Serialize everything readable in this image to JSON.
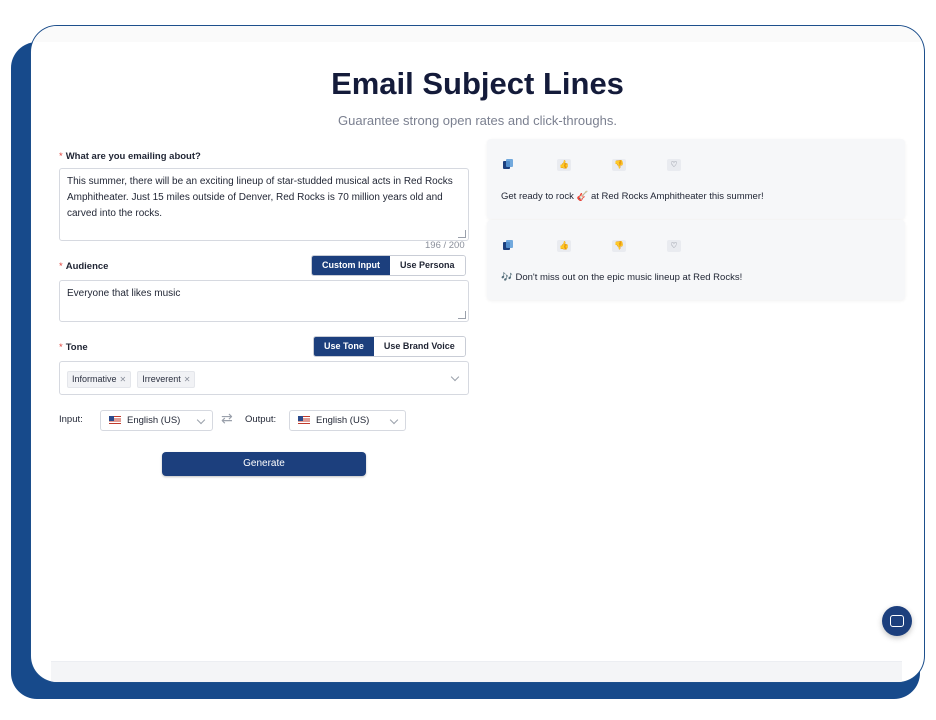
{
  "header": {
    "title": "Email Subject Lines",
    "subtitle": "Guarantee strong open rates and click-throughs."
  },
  "form": {
    "topic": {
      "label": "What are you emailing about?",
      "value": "This summer, there will be an exciting lineup of star-studded musical acts in Red Rocks Amphitheater. Just 15 miles outside of Denver, Red Rocks is 70 million years old and carved into the rocks.",
      "counter": "196 / 200"
    },
    "audience": {
      "label": "Audience",
      "value": "Everyone that likes music",
      "options": [
        "Custom Input",
        "Use Persona"
      ],
      "selected": "Custom Input"
    },
    "tone": {
      "label": "Tone",
      "options": [
        "Use Tone",
        "Use Brand Voice"
      ],
      "selected": "Use Tone",
      "tags": [
        "Informative",
        "Irreverent"
      ]
    },
    "language": {
      "input_label": "Input:",
      "input_value": "English (US)",
      "output_label": "Output:",
      "output_value": "English (US)"
    },
    "generate_label": "Generate"
  },
  "results": [
    {
      "text": "Get ready to rock 🎸 at Red Rocks Amphitheater this summer!"
    },
    {
      "text": "🎶 Don't miss out on the epic music lineup at Red Rocks!"
    }
  ],
  "colors": {
    "primary": "#1c3f7d",
    "frame_blue": "#174a8b",
    "required": "#e0413a"
  }
}
